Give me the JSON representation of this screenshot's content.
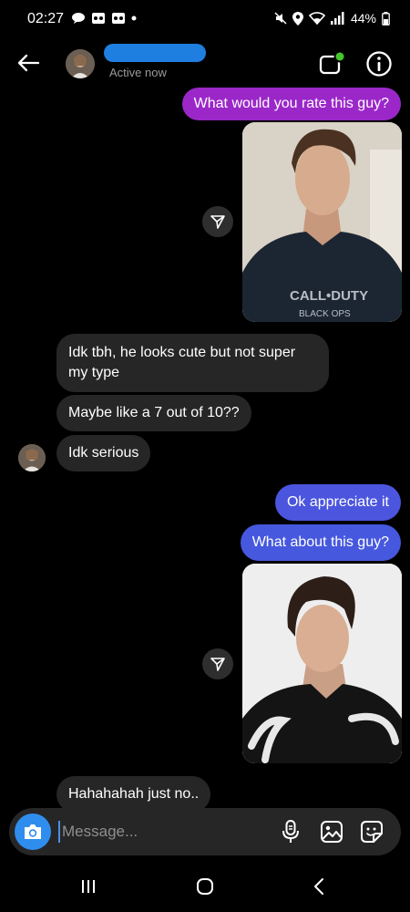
{
  "status_bar": {
    "time": "02:27",
    "battery": "44%",
    "icons": [
      "message-icon",
      "voicemail-icon",
      "voicemail-icon",
      "dot-icon",
      "mute-icon",
      "location-icon",
      "wifi-icon",
      "signal-icon",
      "battery-icon"
    ]
  },
  "header": {
    "status": "Active now",
    "buttons": [
      "back-arrow-icon",
      "video-call-icon",
      "info-icon"
    ]
  },
  "messages": [
    {
      "direction": "out",
      "text": "What would you rate this guy?",
      "color": "#9b27c9"
    },
    {
      "direction": "out",
      "type": "photo",
      "icon": "share-icon"
    },
    {
      "direction": "in",
      "text": "Idk tbh, he looks cute but not super my type"
    },
    {
      "direction": "in",
      "text": "Maybe like a 7 out of 10??"
    },
    {
      "direction": "in",
      "text": "Idk serious"
    },
    {
      "direction": "out",
      "text": "Ok appreciate it",
      "color": "#4b55dd"
    },
    {
      "direction": "out",
      "text": "What about this guy?",
      "color": "#4658de"
    },
    {
      "direction": "out",
      "type": "photo",
      "icon": "share-icon"
    },
    {
      "direction": "in",
      "text": "Hahahahah just no.."
    }
  ],
  "composer": {
    "placeholder": "Message...",
    "icons": [
      "camera-icon",
      "microphone-icon",
      "gallery-icon",
      "sticker-icon"
    ]
  },
  "colors": {
    "background": "#000000",
    "incoming_bubble": "#262626",
    "camera_button": "#2f8dee"
  },
  "navbar": {
    "buttons": [
      "recents-icon",
      "home-icon",
      "back-icon"
    ]
  }
}
